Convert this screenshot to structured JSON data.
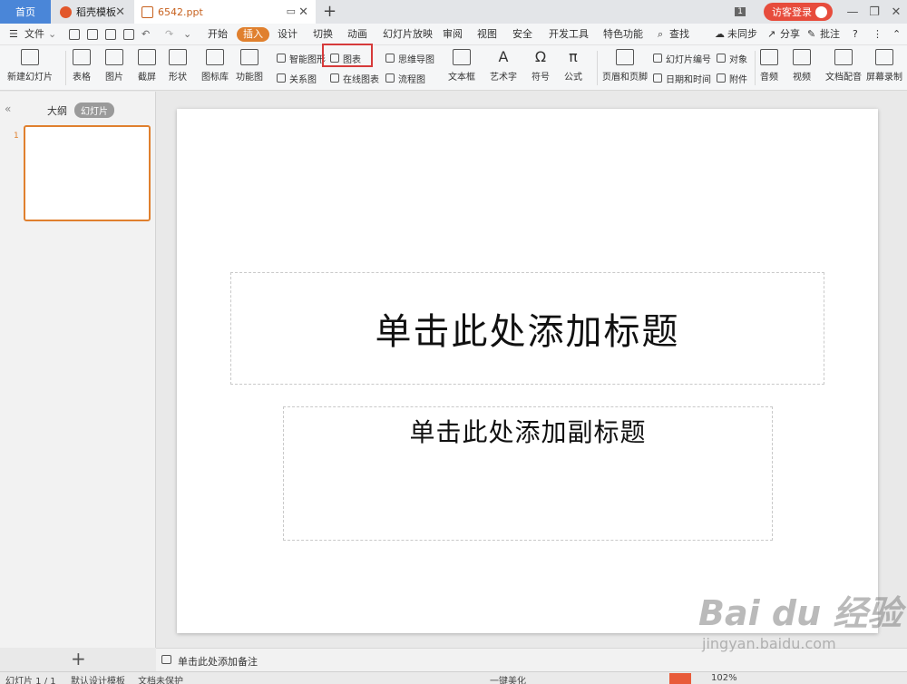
{
  "tabs": {
    "home": "首页",
    "daoke": "稻壳模板",
    "file": "6542.ppt",
    "add": "+",
    "badge": "1",
    "login": "访客登录"
  },
  "menu": {
    "file": "文件",
    "items": [
      "开始",
      "插入",
      "设计",
      "切换",
      "动画",
      "幻灯片放映",
      "审阅",
      "视图",
      "安全",
      "开发工具",
      "特色功能"
    ],
    "search": "查找",
    "sync": "未同步",
    "share": "分享",
    "comment": "批注"
  },
  "ribbon": {
    "new_slide": "新建幻灯片",
    "table": "表格",
    "picture": "图片",
    "screenshot": "截屏",
    "shape": "形状",
    "icon_lib": "图标库",
    "func_chart": "功能图",
    "smart_graphic": "智能图形",
    "chart": "图表",
    "relation": "关系图",
    "online_chart": "在线图表",
    "mindmap": "思维导图",
    "flowchart": "流程图",
    "textbox": "文本框",
    "wordart": "艺术字",
    "symbol": "符号",
    "formula": "公式",
    "header_footer": "页眉和页脚",
    "slide_number": "幻灯片编号",
    "object": "对象",
    "datetime": "日期和时间",
    "attachment": "附件",
    "audio": "音频",
    "video": "视频",
    "doc_voice": "文档配音",
    "screen_record": "屏幕录制"
  },
  "left_panel": {
    "outline": "大纲",
    "slides": "幻灯片",
    "thumb_number": "1"
  },
  "slide": {
    "title": "单击此处添加标题",
    "subtitle": "单击此处添加副标题"
  },
  "notes": "单击此处添加备注",
  "status": {
    "slide_info": "幻灯片 1 / 1",
    "template": "默认设计模板",
    "doc_protect": "文档未保护",
    "beautify": "一键美化",
    "zoom": "102%"
  },
  "watermark": {
    "brand": "Bai du 经验",
    "url": "jingyan.baidu.com"
  }
}
